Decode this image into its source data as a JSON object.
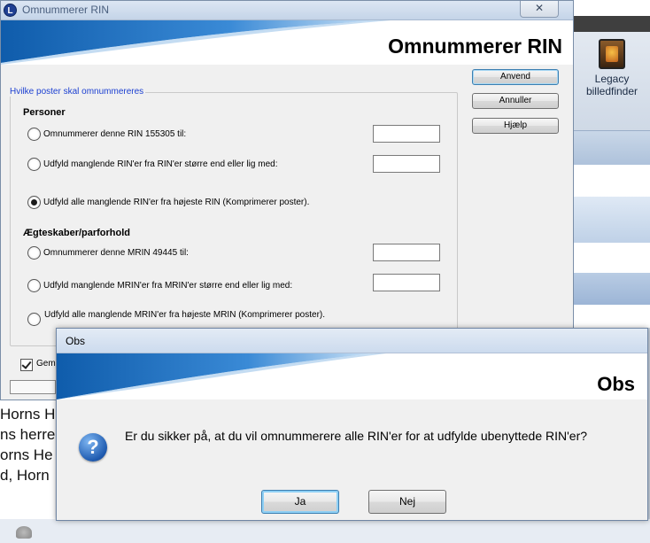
{
  "background": {
    "legacy_button_label": "Legacy billedfinder",
    "partial_texts": [
      "Horns H",
      "ns herre",
      "orns He",
      "d, Horn"
    ]
  },
  "main_dialog": {
    "window_title": "Omnummerer RIN",
    "banner_title": "Omnummerer RIN",
    "close_glyph": "✕",
    "buttons": {
      "apply": "Anvend",
      "cancel": "Annuller",
      "help": "Hjælp"
    },
    "group_label": "Hvilke poster skal omnummereres",
    "persons": {
      "heading": "Personer",
      "options": [
        {
          "label": "Omnummerer denne RIN 155305 til:",
          "selected": false,
          "has_field": true,
          "value": ""
        },
        {
          "label": "Udfyld manglende RIN'er fra RIN'er større end eller lig med:",
          "selected": false,
          "has_field": true,
          "value": ""
        },
        {
          "label": "Udfyld alle manglende RIN'er fra højeste RIN (Komprimerer poster).",
          "selected": true,
          "has_field": false
        }
      ]
    },
    "marriages": {
      "heading": "Ægteskaber/parforhold",
      "options": [
        {
          "label": "Omnummerer denne MRIN 49445 til:",
          "selected": false,
          "has_field": true,
          "value": ""
        },
        {
          "label": "Udfyld manglende MRIN'er fra MRIN'er større end eller lig med:",
          "selected": false,
          "has_field": true,
          "value": ""
        },
        {
          "label": "Udfyld alle manglende MRIN'er fra højeste MRIN (Komprimerer poster).",
          "selected": false,
          "has_field": false
        }
      ]
    },
    "checkbox_label": "Gem",
    "checkbox_checked": true
  },
  "confirm_dialog": {
    "window_title": "Obs",
    "banner_title": "Obs",
    "icon": "question-icon",
    "message": "Er du sikker på, at du vil omnummerere alle RIN'er for at udfylde ubenyttede RIN'er?",
    "buttons": {
      "yes": "Ja",
      "no": "Nej"
    }
  }
}
